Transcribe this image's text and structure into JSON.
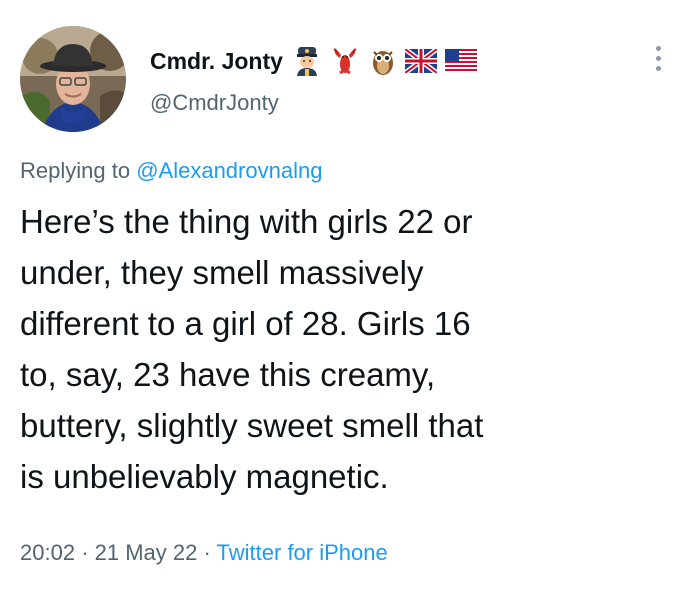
{
  "tweet": {
    "display_name": "Cmdr. Jonty",
    "handle": "@CmdrJonty",
    "name_emojis": [
      "police-officer-emoji",
      "lobster-emoji",
      "owl-emoji",
      "uk-flag-emoji",
      "us-flag-emoji"
    ],
    "replying_prefix": "Replying to",
    "replying_to": "@Alexandrovnalng",
    "text": "Here’s the thing with girls 22 or\nunder, they smell massively\ndifferent to a girl of 28. Girls 16\nto, say, 23 have this creamy,\nbuttery,  slightly sweet smell that\nis unbelievably magnetic.",
    "time": "20:02",
    "date": "21 May 22",
    "separator": "·",
    "source": "Twitter for iPhone"
  },
  "colors": {
    "text": "#0f1419",
    "secondary": "#536471",
    "link": "#1d9bf0"
  }
}
